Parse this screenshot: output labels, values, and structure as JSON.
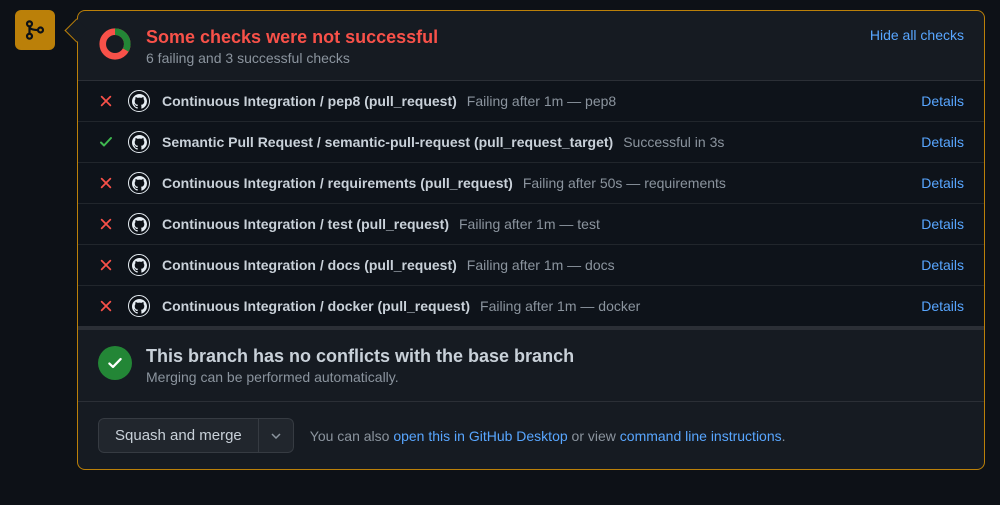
{
  "header": {
    "title": "Some checks were not successful",
    "subtitle": "6 failing and 3 successful checks",
    "hide_link": "Hide all checks"
  },
  "checks": [
    {
      "status": "fail",
      "name": "Continuous Integration / pep8 (pull_request)",
      "detail": "Failing after 1m — pep8",
      "link": "Details"
    },
    {
      "status": "pass",
      "name": "Semantic Pull Request / semantic-pull-request (pull_request_target)",
      "detail": "Successful in 3s",
      "link": "Details"
    },
    {
      "status": "fail",
      "name": "Continuous Integration / requirements (pull_request)",
      "detail": "Failing after 50s — requirements",
      "link": "Details"
    },
    {
      "status": "fail",
      "name": "Continuous Integration / test (pull_request)",
      "detail": "Failing after 1m — test",
      "link": "Details"
    },
    {
      "status": "fail",
      "name": "Continuous Integration / docs (pull_request)",
      "detail": "Failing after 1m — docs",
      "link": "Details"
    },
    {
      "status": "fail",
      "name": "Continuous Integration / docker (pull_request)",
      "detail": "Failing after 1m — docker",
      "link": "Details"
    }
  ],
  "conflict": {
    "title": "This branch has no conflicts with the base branch",
    "subtitle": "Merging can be performed automatically."
  },
  "merge": {
    "button": "Squash and merge",
    "prefix": "You can also ",
    "link1": "open this in GitHub Desktop",
    "mid": " or view ",
    "link2": "command line instructions",
    "suffix": "."
  }
}
